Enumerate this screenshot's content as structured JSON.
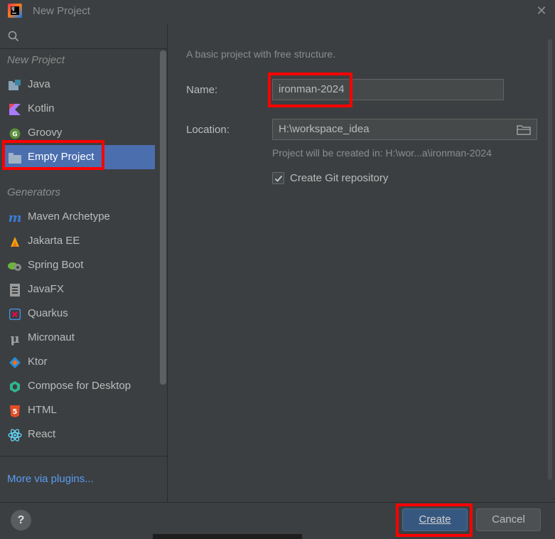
{
  "window": {
    "title": "New Project"
  },
  "sidebar": {
    "search_placeholder": "",
    "sections": [
      {
        "header": "New Project",
        "items": [
          {
            "label": "Java",
            "icon": "java-folder-icon"
          },
          {
            "label": "Kotlin",
            "icon": "kotlin-icon"
          },
          {
            "label": "Groovy",
            "icon": "groovy-icon"
          },
          {
            "label": "Empty Project",
            "icon": "folder-icon",
            "selected": true
          }
        ]
      },
      {
        "header": "Generators",
        "items": [
          {
            "label": "Maven Archetype",
            "icon": "maven-icon"
          },
          {
            "label": "Jakarta EE",
            "icon": "jakarta-icon"
          },
          {
            "label": "Spring Boot",
            "icon": "spring-boot-icon"
          },
          {
            "label": "JavaFX",
            "icon": "javafx-icon"
          },
          {
            "label": "Quarkus",
            "icon": "quarkus-icon"
          },
          {
            "label": "Micronaut",
            "icon": "micronaut-icon"
          },
          {
            "label": "Ktor",
            "icon": "ktor-icon"
          },
          {
            "label": "Compose for Desktop",
            "icon": "compose-icon"
          },
          {
            "label": "HTML",
            "icon": "html5-icon"
          },
          {
            "label": "React",
            "icon": "react-icon"
          }
        ]
      }
    ],
    "more_plugins": "More via plugins..."
  },
  "main": {
    "description": "A basic project with free structure.",
    "name_label": "Name:",
    "name_value": "ironman-2024",
    "location_label": "Location:",
    "location_value": "H:\\workspace_idea",
    "hint": "Project will be created in: H:\\wor...a\\ironman-2024",
    "git_checkbox_label": "Create Git repository",
    "git_checked": true
  },
  "footer": {
    "help_label": "?",
    "create_label": "Create",
    "cancel_label": "Cancel"
  },
  "colors": {
    "background": "#3c3f41",
    "selection": "#4b6eaf",
    "highlight_box": "#ff0000",
    "link": "#589df6",
    "primary_button": "#365880"
  }
}
